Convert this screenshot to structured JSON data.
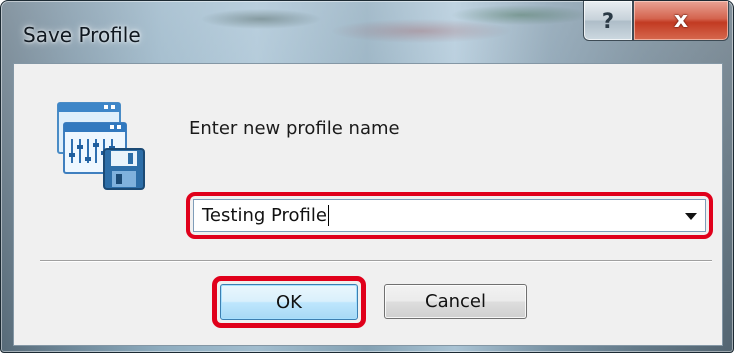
{
  "window": {
    "title": "Save Profile",
    "help_label": "?",
    "close_label": "x"
  },
  "dialog": {
    "prompt": "Enter new profile name",
    "profile_name_value": "Testing Profile",
    "app_icon": "profile-save-icon",
    "dropdown_icon": "chevron-down-icon"
  },
  "buttons": {
    "ok_label": "OK",
    "cancel_label": "Cancel"
  },
  "colors": {
    "highlight": "#e0001b",
    "close_button": "#c23a22",
    "ok_button": "#bee6fd",
    "client_background": "#f0f0f0"
  }
}
